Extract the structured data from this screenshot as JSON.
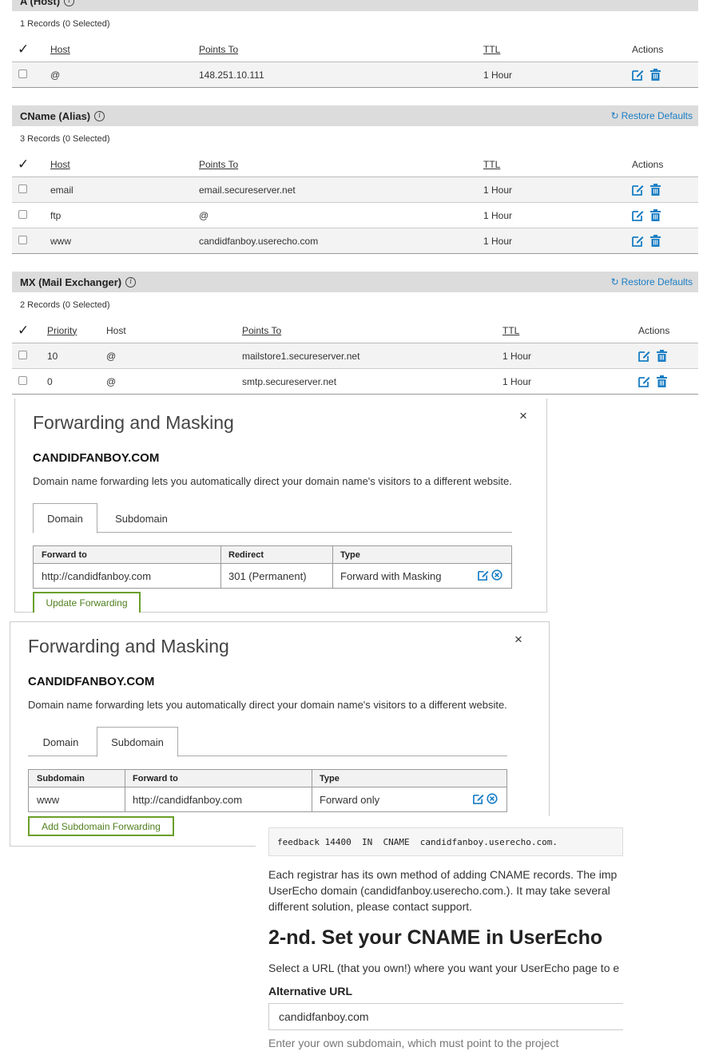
{
  "a_host": {
    "title": "A (Host)",
    "count": "1 Records (0 Selected)",
    "headers": {
      "host": "Host",
      "points_to": "Points To",
      "ttl": "TTL",
      "actions": "Actions"
    },
    "rows": [
      {
        "host": "@",
        "points_to": "148.251.10.111",
        "ttl": "1 Hour"
      }
    ]
  },
  "cname": {
    "title": "CName (Alias)",
    "restore": "Restore Defaults",
    "count": "3 Records (0 Selected)",
    "headers": {
      "host": "Host",
      "points_to": "Points To",
      "ttl": "TTL",
      "actions": "Actions"
    },
    "rows": [
      {
        "host": "email",
        "points_to": "email.secureserver.net",
        "ttl": "1 Hour"
      },
      {
        "host": "ftp",
        "points_to": "@",
        "ttl": "1 Hour"
      },
      {
        "host": "www",
        "points_to": "candidfanboy.userecho.com",
        "ttl": "1 Hour"
      }
    ]
  },
  "mx": {
    "title": "MX (Mail Exchanger)",
    "restore": "Restore Defaults",
    "count": "2 Records (0 Selected)",
    "headers": {
      "priority": "Priority",
      "host": "Host",
      "points_to": "Points To",
      "ttl": "TTL",
      "actions": "Actions"
    },
    "rows": [
      {
        "priority": "10",
        "host": "@",
        "points_to": "mailstore1.secureserver.net",
        "ttl": "1 Hour"
      },
      {
        "priority": "0",
        "host": "@",
        "points_to": "smtp.secureserver.net",
        "ttl": "1 Hour"
      }
    ]
  },
  "fwd1": {
    "title": "Forwarding and Masking",
    "close": "×",
    "domain": "CANDIDFANBOY.COM",
    "desc": "Domain name forwarding lets you automatically direct your domain name's visitors to a different website.",
    "tabs": [
      "Domain",
      "Subdomain"
    ],
    "active_tab": "Domain",
    "headers": {
      "forward_to": "Forward to",
      "redirect": "Redirect",
      "type": "Type"
    },
    "row": {
      "forward_to": "http://candidfanboy.com",
      "redirect": "301 (Permanent)",
      "type": "Forward with Masking"
    },
    "button": "Update Forwarding"
  },
  "fwd2": {
    "title": "Forwarding and Masking",
    "close": "×",
    "domain": "CANDIDFANBOY.COM",
    "desc": "Domain name forwarding lets you automatically direct your domain name's visitors to a different website.",
    "tabs": [
      "Domain",
      "Subdomain"
    ],
    "active_tab": "Subdomain",
    "headers": {
      "subdomain": "Subdomain",
      "forward_to": "Forward to",
      "type": "Type"
    },
    "row": {
      "subdomain": "www",
      "forward_to": "http://candidfanboy.com",
      "type": "Forward only"
    },
    "button": "Add Subdomain Forwarding"
  },
  "userecho": {
    "code": "feedback 14400  IN  CNAME  candidfanboy.userecho.com.",
    "para_lines": [
      "Each registrar has its own method of adding CNAME records. The imp",
      "UserEcho domain (candidfanboy.userecho.com.). It may take several",
      "different solution, please contact support."
    ],
    "heading": "2-nd. Set your CNAME in UserEcho",
    "sub": "Select a URL (that you own!) where you want your UserEcho page to e",
    "label": "Alternative URL",
    "input_value": "candidfanboy.com",
    "help": "Enter your own subdomain, which must point to the project"
  },
  "colors": {
    "link_blue": "#1a7ec4",
    "green_button": "#6a9f2a",
    "section_bg": "#dcdcdc"
  },
  "icons": {
    "edit": "edit-icon",
    "delete": "trash-icon",
    "restore": "refresh-icon",
    "info": "info-icon",
    "remove": "circle-x-icon"
  }
}
